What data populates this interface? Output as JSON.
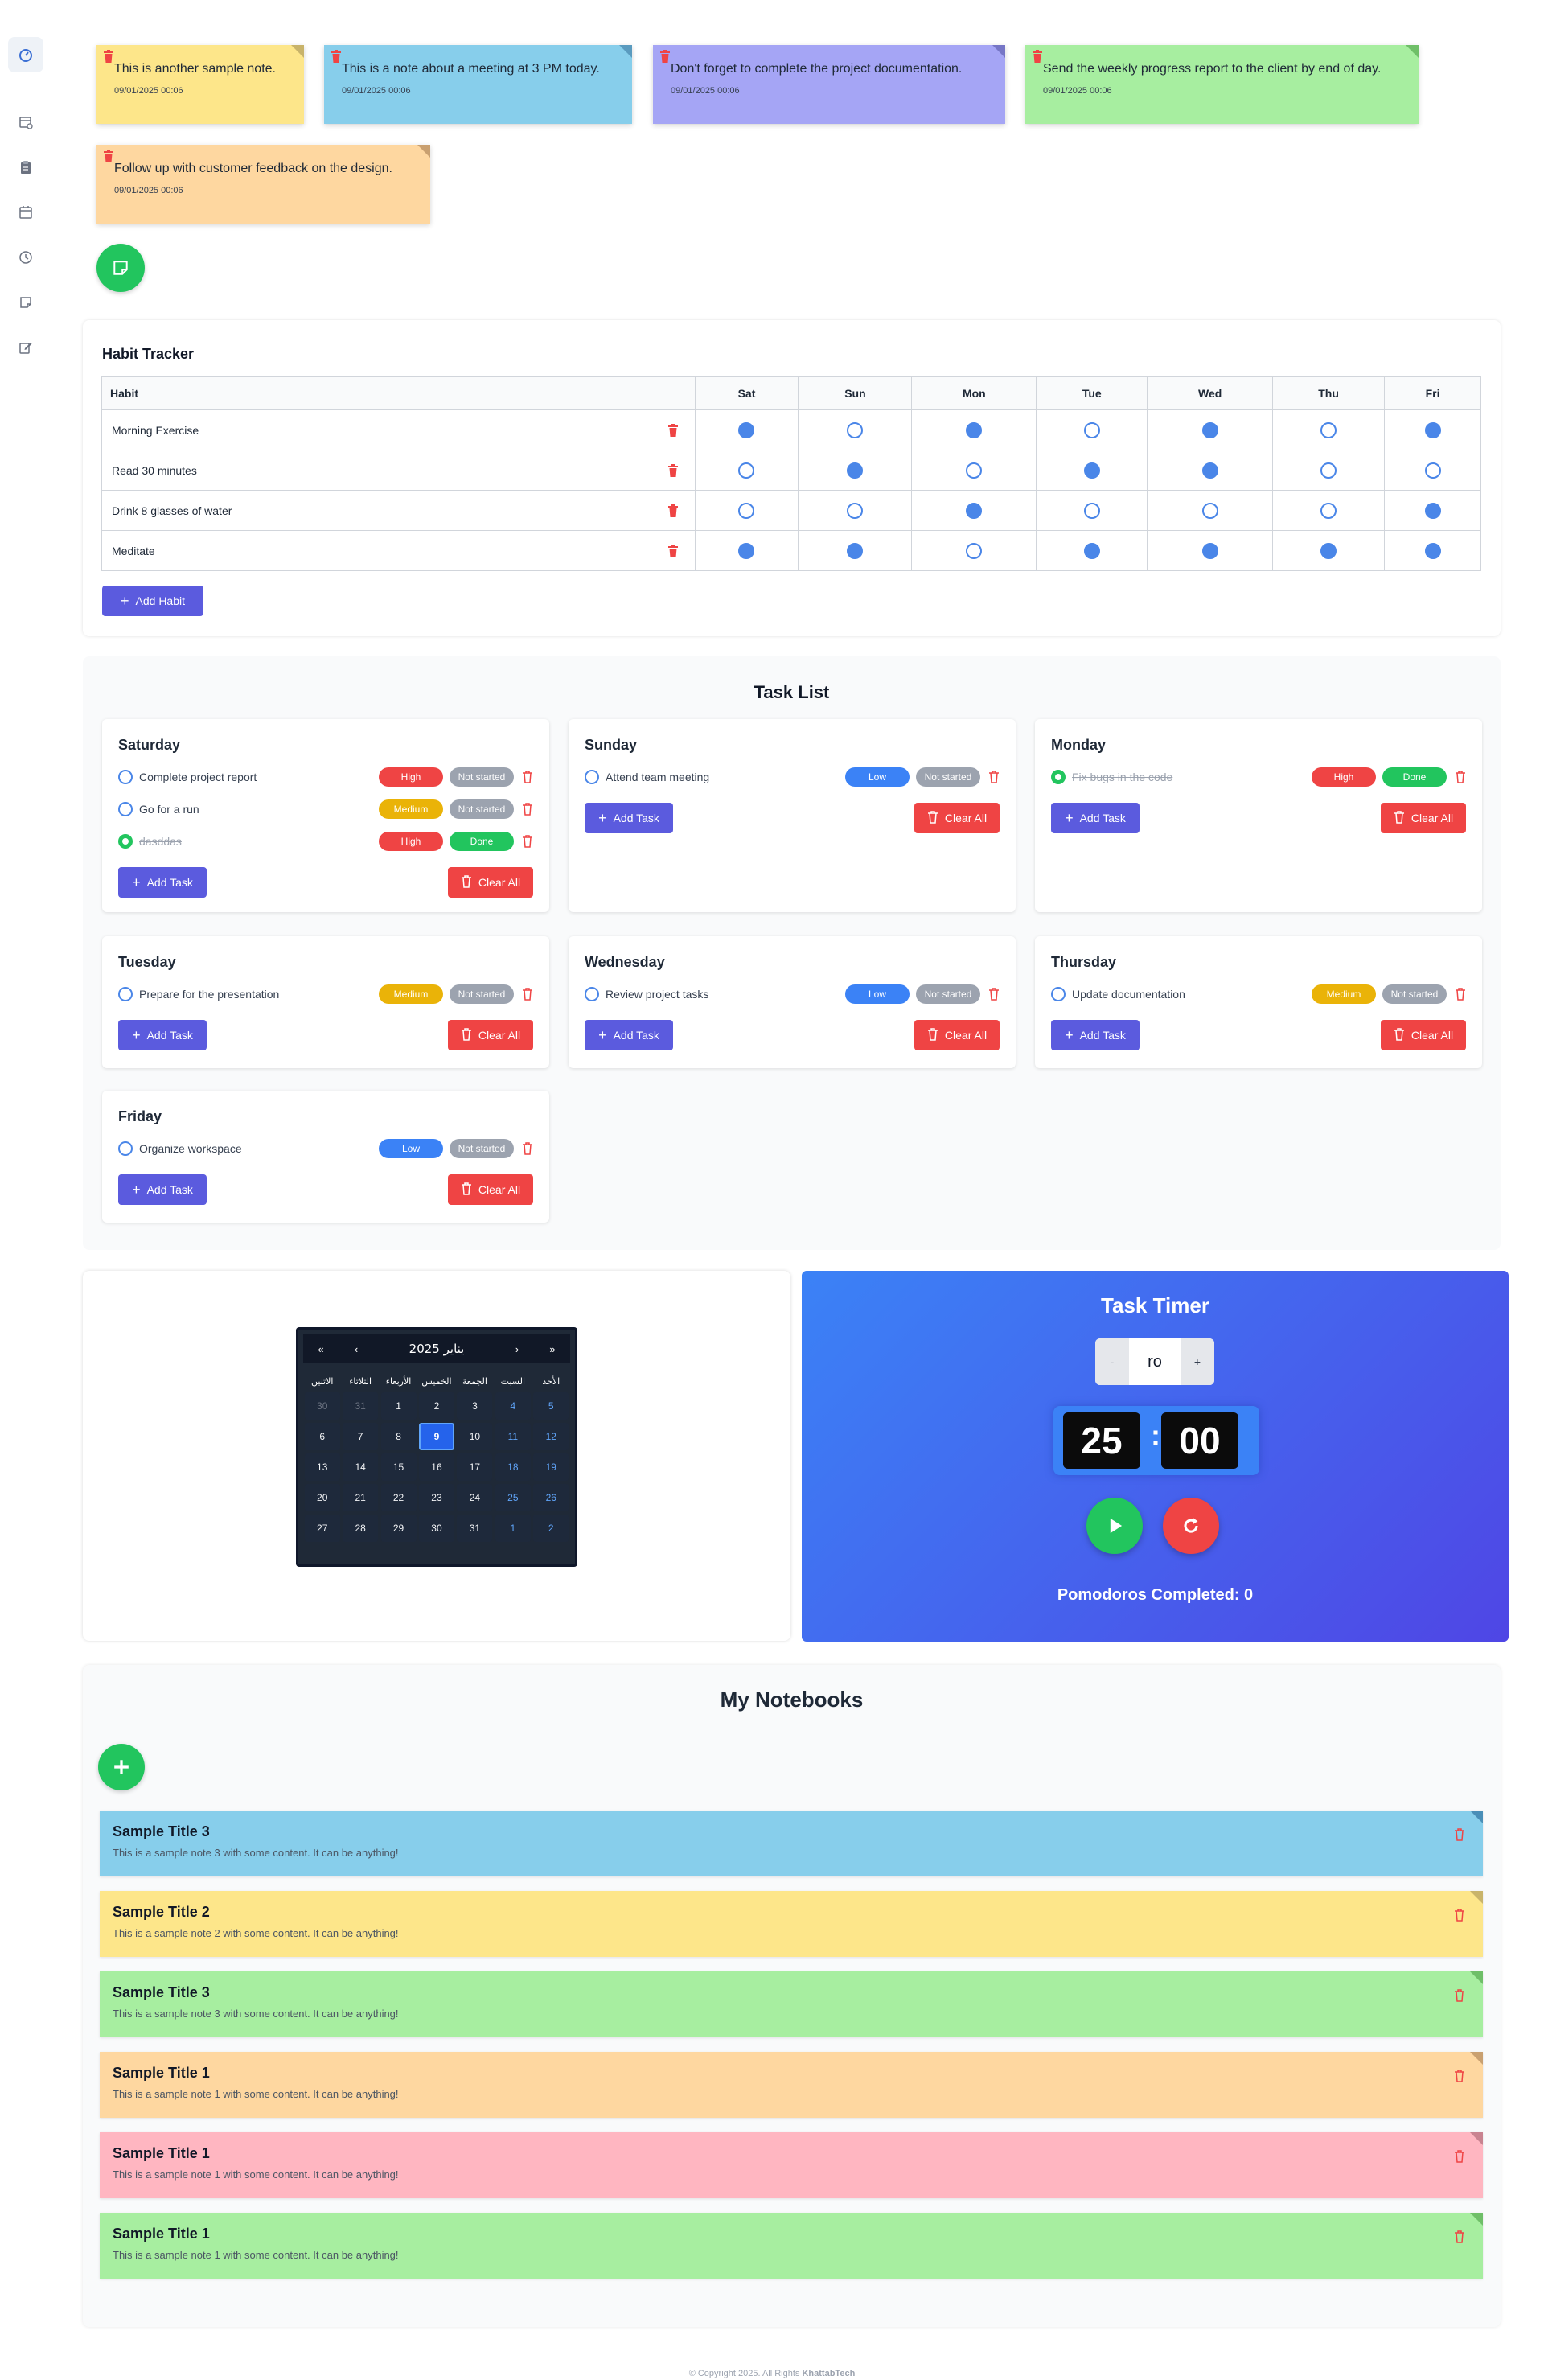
{
  "sidebar": {
    "items": [
      {
        "icon": "dashboard-icon",
        "active": true
      },
      {
        "icon": "calendar-clock-icon"
      },
      {
        "icon": "clipboard-icon"
      },
      {
        "icon": "calendar-icon"
      },
      {
        "icon": "clock-icon"
      },
      {
        "icon": "sticky-note-icon"
      },
      {
        "icon": "edit-icon"
      }
    ]
  },
  "sticky_notes": [
    {
      "text": "This is another sample note.",
      "date": "09/01/2025 00:06",
      "color": "#fde68a",
      "corner": "#c8b36a"
    },
    {
      "text": "This is a note about a meeting at 3 PM today.",
      "date": "09/01/2025 00:06",
      "color": "#87ceeb",
      "corner": "#5a9bbf"
    },
    {
      "text": "Don't forget to complete the project documentation.",
      "date": "09/01/2025 00:06",
      "color": "#a5a5f5",
      "corner": "#7676c6"
    },
    {
      "text": "Send the weekly progress report to the client by end of day.",
      "date": "09/01/2025 00:06",
      "color": "#a7eea0",
      "corner": "#6fbf68"
    },
    {
      "text": "Follow up with customer feedback on the design.",
      "date": "09/01/2025 00:06",
      "color": "#fed7a0",
      "corner": "#c9a070"
    }
  ],
  "habit_tracker": {
    "title": "Habit Tracker",
    "column_header": "Habit",
    "days": [
      "Sat",
      "Sun",
      "Mon",
      "Tue",
      "Wed",
      "Thu",
      "Fri"
    ],
    "habits": [
      {
        "name": "Morning Exercise",
        "checks": [
          true,
          false,
          true,
          false,
          true,
          false,
          true
        ]
      },
      {
        "name": "Read 30 minutes",
        "checks": [
          false,
          true,
          false,
          true,
          true,
          false,
          false
        ]
      },
      {
        "name": "Drink 8 glasses of water",
        "checks": [
          false,
          false,
          true,
          false,
          false,
          false,
          true
        ]
      },
      {
        "name": "Meditate",
        "checks": [
          true,
          true,
          false,
          true,
          true,
          true,
          true
        ]
      }
    ],
    "add_label": "Add Habit"
  },
  "task_list": {
    "title": "Task List",
    "add_label": "Add Task",
    "clear_label": "Clear All",
    "days": [
      {
        "name": "Saturday",
        "tasks": [
          {
            "name": "Complete project report",
            "priority": "High",
            "status": "Not started",
            "done": false
          },
          {
            "name": "Go for a run",
            "priority": "Medium",
            "status": "Not started",
            "done": false
          },
          {
            "name": "dasddas",
            "priority": "High",
            "status": "Done",
            "done": true
          }
        ]
      },
      {
        "name": "Sunday",
        "tasks": [
          {
            "name": "Attend team meeting",
            "priority": "Low",
            "status": "Not started",
            "done": false
          }
        ]
      },
      {
        "name": "Monday",
        "tasks": [
          {
            "name": "Fix bugs in the code",
            "priority": "High",
            "status": "Done",
            "done": true
          }
        ]
      },
      {
        "name": "Tuesday",
        "tasks": [
          {
            "name": "Prepare for the presentation",
            "priority": "Medium",
            "status": "Not started",
            "done": false
          }
        ]
      },
      {
        "name": "Wednesday",
        "tasks": [
          {
            "name": "Review project tasks",
            "priority": "Low",
            "status": "Not started",
            "done": false
          }
        ]
      },
      {
        "name": "Thursday",
        "tasks": [
          {
            "name": "Update documentation",
            "priority": "Medium",
            "status": "Not started",
            "done": false
          }
        ]
      },
      {
        "name": "Friday",
        "tasks": [
          {
            "name": "Organize workspace",
            "priority": "Low",
            "status": "Not started",
            "done": false
          }
        ]
      }
    ]
  },
  "calendar": {
    "month_label": "يناير 2025",
    "nav": {
      "prev_year": "«",
      "prev_month": "‹",
      "next_month": "›",
      "next_year": "»"
    },
    "weekdays": [
      "الاثنين",
      "الثلاثاء",
      "الأربعاء",
      "الخميس",
      "الجمعة",
      "السبت",
      "الأحد"
    ],
    "days": [
      {
        "d": "30",
        "kind": "muted"
      },
      {
        "d": "31",
        "kind": "muted"
      },
      {
        "d": "1"
      },
      {
        "d": "2"
      },
      {
        "d": "3"
      },
      {
        "d": "4",
        "kind": "weekend"
      },
      {
        "d": "5",
        "kind": "weekend"
      },
      {
        "d": "6"
      },
      {
        "d": "7"
      },
      {
        "d": "8"
      },
      {
        "d": "9",
        "kind": "today"
      },
      {
        "d": "10"
      },
      {
        "d": "11",
        "kind": "weekend"
      },
      {
        "d": "12",
        "kind": "weekend"
      },
      {
        "d": "13"
      },
      {
        "d": "14"
      },
      {
        "d": "15"
      },
      {
        "d": "16"
      },
      {
        "d": "17"
      },
      {
        "d": "18",
        "kind": "weekend"
      },
      {
        "d": "19",
        "kind": "weekend"
      },
      {
        "d": "20"
      },
      {
        "d": "21"
      },
      {
        "d": "22"
      },
      {
        "d": "23"
      },
      {
        "d": "24"
      },
      {
        "d": "25",
        "kind": "weekend"
      },
      {
        "d": "26",
        "kind": "weekend"
      },
      {
        "d": "27"
      },
      {
        "d": "28"
      },
      {
        "d": "29"
      },
      {
        "d": "30"
      },
      {
        "d": "31"
      },
      {
        "d": "1",
        "kind": "weekend"
      },
      {
        "d": "2",
        "kind": "weekend"
      }
    ]
  },
  "timer": {
    "title": "Task Timer",
    "minus": "-",
    "plus": "+",
    "stepper_value": "ro",
    "minutes": "25",
    "separator": ":",
    "seconds": "00",
    "pomodoros_label": "Pomodoros Completed: 0"
  },
  "notebooks": {
    "title": "My Notebooks",
    "items": [
      {
        "title": "Sample Title 3",
        "content": "This is a sample note 3 with some content. It can be anything!",
        "color": "#87ceeb",
        "corner": "#4a8fb8"
      },
      {
        "title": "Sample Title 2",
        "content": "This is a sample note 2 with some content. It can be anything!",
        "color": "#fde68a",
        "corner": "#c9b46a"
      },
      {
        "title": "Sample Title 3",
        "content": "This is a sample note 3 with some content. It can be anything!",
        "color": "#a7eea0",
        "corner": "#6fbf68"
      },
      {
        "title": "Sample Title 1",
        "content": "This is a sample note 1 with some content. It can be anything!",
        "color": "#fed7a0",
        "corner": "#c9a070"
      },
      {
        "title": "Sample Title 1",
        "content": "This is a sample note 1 with some content. It can be anything!",
        "color": "#ffb6c1",
        "corner": "#c98390"
      },
      {
        "title": "Sample Title 1",
        "content": "This is a sample note 1 with some content. It can be anything!",
        "color": "#a7eea0",
        "corner": "#6fbf68"
      }
    ]
  },
  "footer": {
    "text": "© Copyright 2025. All Rights ",
    "brand": "KhattabTech"
  }
}
